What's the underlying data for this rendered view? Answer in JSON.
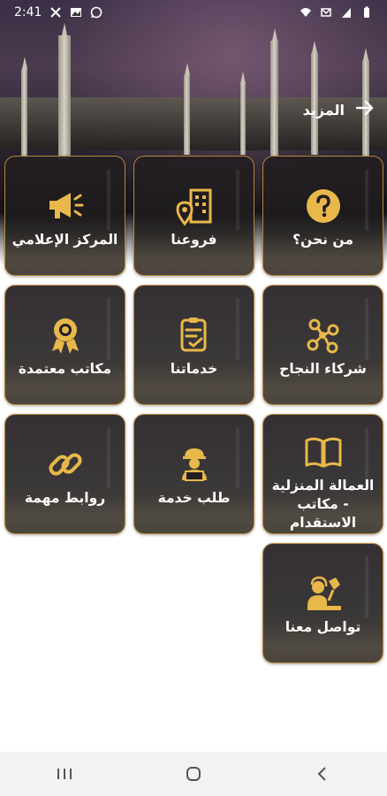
{
  "status_bar": {
    "time": "2:41",
    "left_icons": [
      "x-icon",
      "image-icon",
      "whatsapp-icon"
    ],
    "right_icons": [
      "wifi-icon",
      "alarm-icon",
      "signal-icon",
      "battery-icon"
    ]
  },
  "header": {
    "more_label": "المزيد",
    "more_icon": "arrow-right-icon"
  },
  "tiles": [
    {
      "label": "من نحن؟",
      "icon": "question-icon"
    },
    {
      "label": "فروعنا",
      "icon": "building-location-icon"
    },
    {
      "label": "المركز الإعلامي",
      "icon": "megaphone-icon"
    },
    {
      "label": "شركاء النجاح",
      "icon": "network-icon"
    },
    {
      "label": "خدماتنا",
      "icon": "document-check-icon"
    },
    {
      "label": "مكاتب معتمدة",
      "icon": "award-icon"
    },
    {
      "label": "العمالة المنزلية - مكاتب الاستقدام",
      "icon": "book-icon"
    },
    {
      "label": "طلب خدمة",
      "icon": "worker-laptop-icon"
    },
    {
      "label": "روابط مهمة",
      "icon": "link-icon"
    },
    {
      "label": "تواصل معنا",
      "icon": "support-agent-icon"
    }
  ],
  "nav_bar": {
    "buttons": [
      "recent-apps-icon",
      "home-icon",
      "back-icon"
    ]
  },
  "colors": {
    "gold": "#e8b84a",
    "tile_border": "#b8893a",
    "tile_bg": "#231e22"
  }
}
